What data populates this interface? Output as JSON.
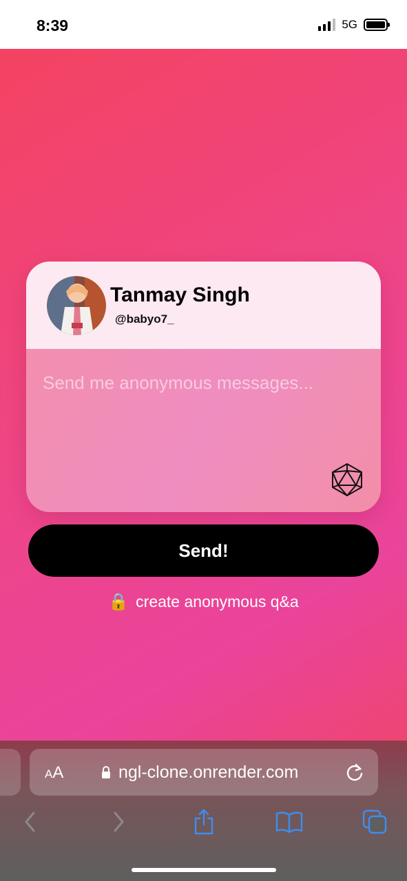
{
  "status_bar": {
    "time": "8:39",
    "network": "5G",
    "signal_bars_active": 3,
    "signal_bars_total": 4
  },
  "profile": {
    "name": "Tanmay Singh",
    "handle": "@babyo7_"
  },
  "message": {
    "placeholder": "Send me anonymous messages...",
    "value": ""
  },
  "send_button": {
    "label": "Send!"
  },
  "create_link": {
    "icon": "lock-icon",
    "label": "create anonymous q&a"
  },
  "browser": {
    "aa_label_small": "A",
    "aa_label_large": "A",
    "url": "ngl-clone.onrender.com",
    "toolbar_icons": [
      "back-icon",
      "forward-icon",
      "share-icon",
      "bookmarks-icon",
      "tabs-icon"
    ]
  },
  "colors": {
    "background_start": "#f4435d",
    "background_mid": "#ea449b",
    "card_header": "#fde9f1",
    "message_area": "#f08dba",
    "send_button": "#000000",
    "toolbar_accent": "#3d8ef0"
  }
}
